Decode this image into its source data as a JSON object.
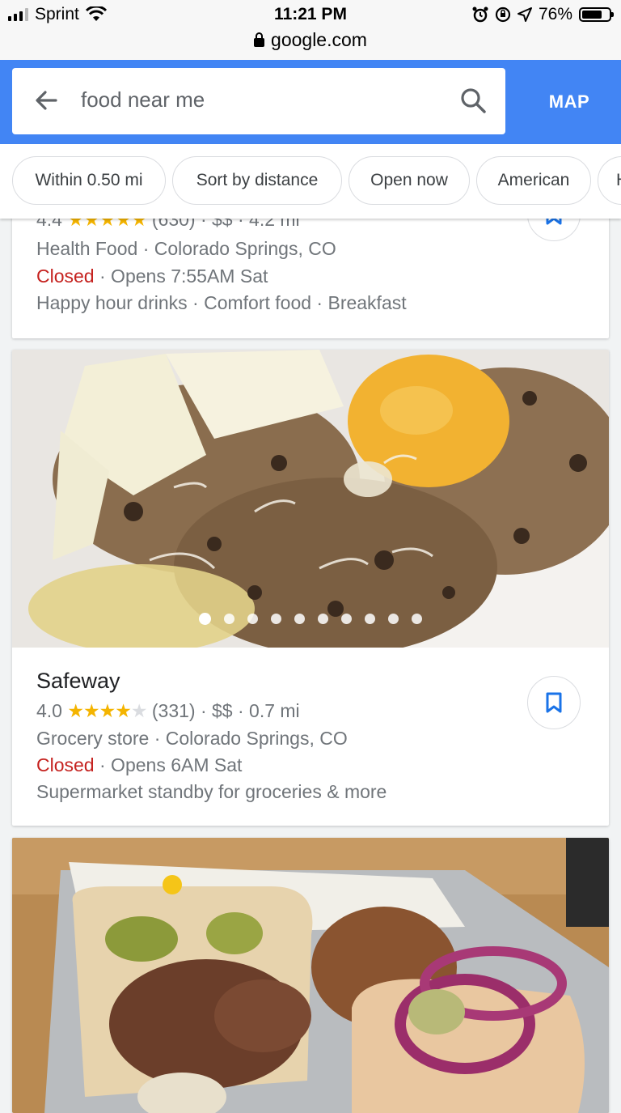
{
  "status_bar": {
    "carrier": "Sprint",
    "time": "11:21 PM",
    "battery": "76%",
    "battery_level": 0.76,
    "url": "google.com"
  },
  "search": {
    "query": "food near me",
    "map_label": "MAP"
  },
  "filters": [
    "Within 0.50 mi",
    "Sort by distance",
    "Open now",
    "American",
    "H"
  ],
  "results": [
    {
      "rating_line_rest": "(630) · $$ · 4.2 mi",
      "rating": "4.4",
      "category": "Health Food · Colorado Springs, CO",
      "status": "Closed",
      "hours": " · Opens 7:55AM Sat",
      "description": "Happy hour drinks · Comfort food · Breakfast"
    },
    {
      "name": "Safeway",
      "rating": "4.0",
      "reviews": "(331) · $$ · 0.7 mi",
      "category": "Grocery store · Colorado Springs, CO",
      "status": "Closed",
      "hours": " · Opens 6AM Sat",
      "description": "Supermarket standby for groceries & more",
      "photo_count": 10,
      "active_photo": 0
    }
  ],
  "colors": {
    "brand_blue": "#4285f4",
    "closed_red": "#c5221f",
    "star_gold": "#f4b400"
  }
}
